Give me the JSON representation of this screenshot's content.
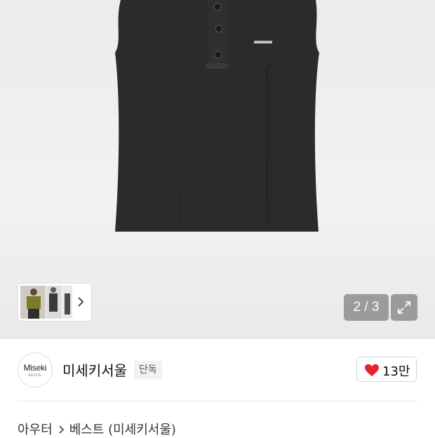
{
  "gallery": {
    "page_counter": "2 / 3",
    "thumbnail_count_visible": 3
  },
  "brand": {
    "logo_text": "Miseki",
    "logo_subtext": "SEOUL",
    "name": "미세키서울",
    "badge": "단독"
  },
  "like": {
    "count": "13만",
    "heart_color": "#e8212e"
  },
  "breadcrumb": {
    "category": "아우터",
    "subcategory": "베스트 (미세키서울)"
  },
  "icons": {
    "expand": "expand-arrows-icon",
    "thumb_next": "chevron-right-icon",
    "like": "heart-icon",
    "breadcrumb_sep": "chevron-right-icon"
  }
}
